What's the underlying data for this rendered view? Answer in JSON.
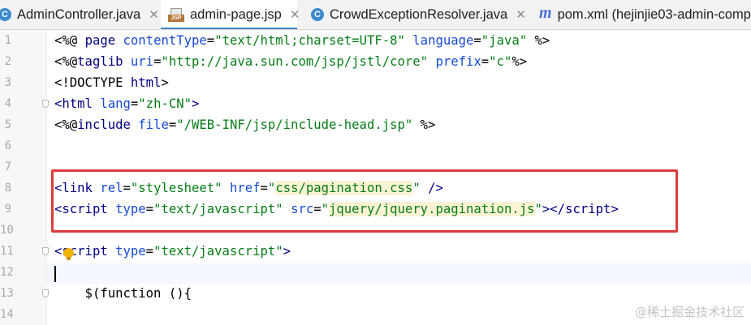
{
  "tabs": [
    {
      "label": "AdminController.java",
      "icon": "class-icon",
      "active": false,
      "closable": true
    },
    {
      "label": "admin-page.jsp",
      "icon": "jsp-file-icon",
      "active": true,
      "closable": true
    },
    {
      "label": "CrowdExceptionResolver.java",
      "icon": "class-icon",
      "active": false,
      "closable": true
    },
    {
      "label": "pom.xml (hejinjie03-admin-comp",
      "icon": "maven-icon",
      "active": false,
      "closable": false
    }
  ],
  "icons": {
    "class_glyph": "C",
    "jsp_glyph": "JSP",
    "maven_glyph": "m",
    "close_glyph": "✕"
  },
  "gutter": {
    "line_numbers": [
      "1",
      "2",
      "3",
      "4",
      "5",
      "6",
      "7",
      "8",
      "9",
      "10",
      "11",
      "12",
      "13",
      "14"
    ]
  },
  "code": {
    "line1": {
      "a": "<%@ ",
      "b": "page ",
      "c": "contentType",
      "d": "=",
      "e": "\"text/html;charset=UTF-8\"",
      "f": " ",
      "g": "language",
      "h": "=",
      "i": "\"java\"",
      "j": " %>"
    },
    "line2": {
      "a": "<%@",
      "b": "taglib ",
      "c": "uri",
      "d": "=",
      "e": "\"http://java.sun.com/jsp/jstl/core\"",
      "f": " ",
      "g": "prefix",
      "h": "=",
      "i": "\"c\"",
      "j": "%>"
    },
    "line3": {
      "a": "<!DOCTYPE ",
      "b": "html",
      "c": ">"
    },
    "line4": {
      "a": "<",
      "b": "html ",
      "c": "lang",
      "d": "=",
      "e": "\"zh-CN\"",
      "f": ">"
    },
    "line5": {
      "a": "<%@",
      "b": "include ",
      "c": "file",
      "d": "=",
      "e": "\"/WEB-INF/jsp/include-head.jsp\"",
      "f": " %>"
    },
    "line8": {
      "a": "<",
      "b": "link ",
      "c": "rel",
      "d": "=",
      "e": "\"stylesheet\"",
      "f": " ",
      "g": "href",
      "h": "=",
      "i": "\"",
      "j": "css/pagination.css",
      "k": "\"",
      "l": " />"
    },
    "line9": {
      "a": "<",
      "b": "script ",
      "c": "type",
      "d": "=",
      "e": "\"text/javascript\"",
      "f": " ",
      "g": "src",
      "h": "=",
      "i": "\"",
      "j": "jquery/jquery.pagination.js",
      "k": "\"",
      "l": "></",
      "m": "script",
      "n": ">"
    },
    "line11": {
      "a": "<",
      "b": "script ",
      "c": "type",
      "d": "=",
      "e": "\"text/javascript\"",
      "f": ">"
    },
    "line13": {
      "a": "    $(function (){"
    }
  },
  "colors": {
    "tag_keyword": "#000080",
    "attribute": "#174ad4",
    "string": "#067d17",
    "highlight_box": "#dc3c3c",
    "active_tab_underline": "#4083c9"
  },
  "watermark": "@稀土掘金技术社区"
}
